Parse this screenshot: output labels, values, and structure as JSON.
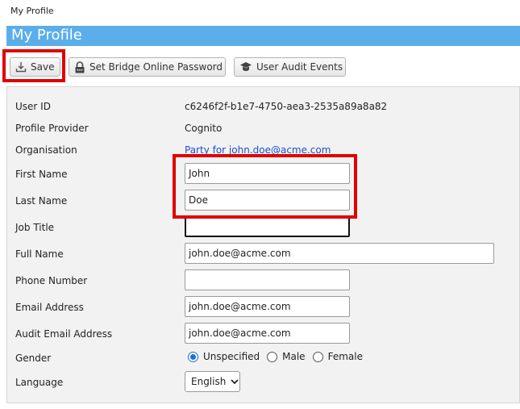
{
  "breadcrumb": "My Profile",
  "page_title": "My Profile",
  "toolbar": {
    "save_label": "Save",
    "bridge_label": "Set Bridge Online Password",
    "audit_label": "User Audit Events"
  },
  "fields": {
    "user_id": {
      "label": "User ID",
      "value": "c6246f2f-b1e7-4750-aea3-2535a89a8a82"
    },
    "profile_provider": {
      "label": "Profile Provider",
      "value": "Cognito"
    },
    "organisation": {
      "label": "Organisation",
      "value": "Party for john.doe@acme.com"
    },
    "first_name": {
      "label": "First Name",
      "value": "John"
    },
    "last_name": {
      "label": "Last Name",
      "value": "Doe"
    },
    "job_title": {
      "label": "Job Title",
      "value": ""
    },
    "full_name": {
      "label": "Full Name",
      "value": "john.doe@acme.com"
    },
    "phone_number": {
      "label": "Phone Number",
      "value": ""
    },
    "email_address": {
      "label": "Email Address",
      "value": "john.doe@acme.com"
    },
    "audit_email_address": {
      "label": "Audit Email Address",
      "value": "john.doe@acme.com"
    },
    "gender": {
      "label": "Gender",
      "options": [
        "Unspecified",
        "Male",
        "Female"
      ],
      "selected": "Unspecified"
    },
    "language": {
      "label": "Language",
      "value": "English"
    }
  },
  "colors": {
    "title_bar": "#5aaeea",
    "highlight": "#e00000",
    "link": "#1a4fd6",
    "radio_selected": "#1a6fd6"
  },
  "icons": {
    "save": "download-tray-icon",
    "bridge": "lock-icon",
    "audit": "user-badge-icon",
    "language": "chevron-down-icon"
  }
}
